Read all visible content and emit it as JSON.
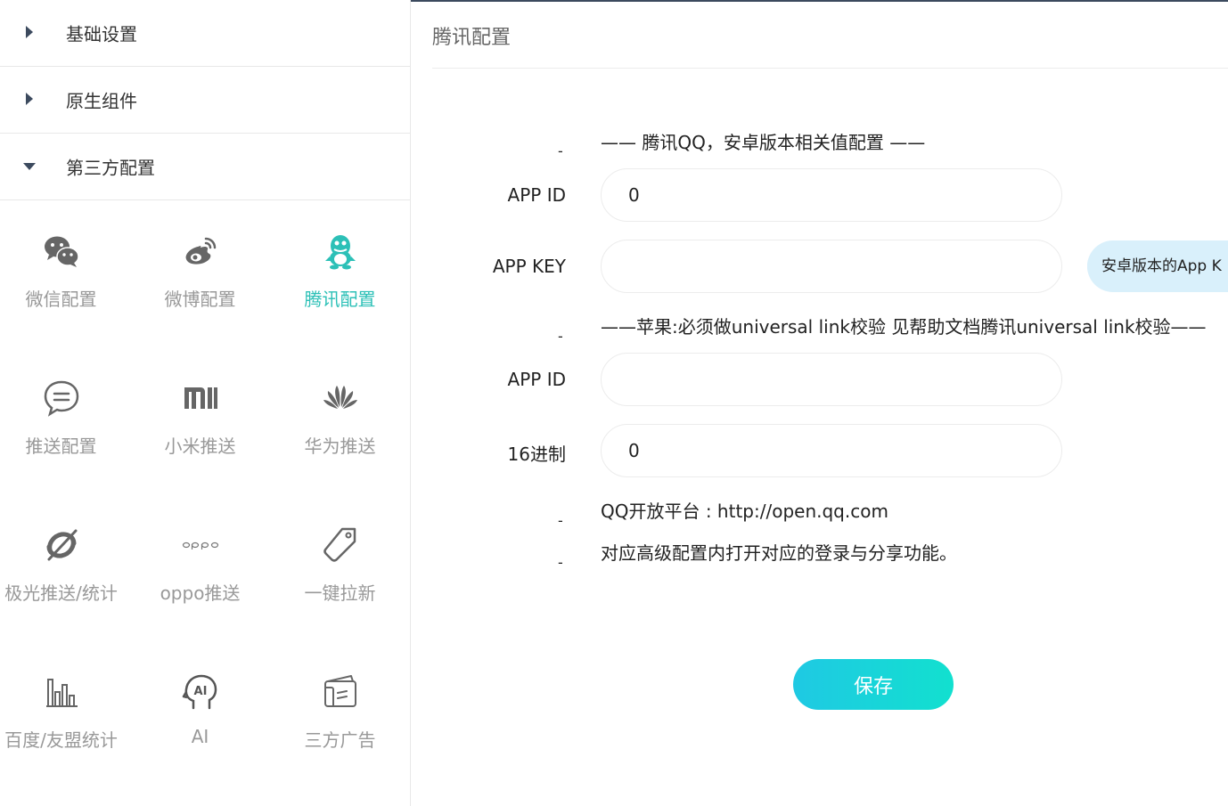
{
  "sidebar": {
    "menus": [
      {
        "label": "基础设置",
        "expanded": false
      },
      {
        "label": "原生组件",
        "expanded": false
      },
      {
        "label": "第三方配置",
        "expanded": true
      }
    ],
    "tiles": [
      {
        "label": "微信配置",
        "icon": "wechat-icon",
        "active": false
      },
      {
        "label": "微博配置",
        "icon": "weibo-icon",
        "active": false
      },
      {
        "label": "腾讯配置",
        "icon": "qq-icon",
        "active": true
      },
      {
        "label": "推送配置",
        "icon": "chat-bubble-icon",
        "active": false
      },
      {
        "label": "小米推送",
        "icon": "xiaomi-icon",
        "active": false
      },
      {
        "label": "华为推送",
        "icon": "huawei-icon",
        "active": false
      },
      {
        "label": "极光推送/统计",
        "icon": "jiguang-icon",
        "active": false
      },
      {
        "label": "oppo推送",
        "icon": "oppo-icon",
        "active": false
      },
      {
        "label": "一键拉新",
        "icon": "tag-icon",
        "active": false
      },
      {
        "label": "百度/友盟统计",
        "icon": "bar-chart-icon",
        "active": false
      },
      {
        "label": "AI",
        "icon": "ai-head-icon",
        "active": false
      },
      {
        "label": "三方广告",
        "icon": "ad-card-icon",
        "active": false
      }
    ]
  },
  "main": {
    "title": "腾讯配置",
    "android_section": "—— 腾讯QQ，安卓版本相关值配置 ——",
    "android_app_id_label": "APP ID",
    "android_app_id_value": "0",
    "android_app_key_label": "APP KEY",
    "android_app_key_value": "",
    "app_key_tooltip": "安卓版本的App K",
    "ios_section": "——苹果:必须做universal link校验 见帮助文档腾讯universal link校验——",
    "ios_app_id_label": "APP ID",
    "ios_app_id_value": "",
    "hex_label": "16进制",
    "hex_value": "0",
    "dash": "-",
    "note_platform": "QQ开放平台 : http://open.qq.com",
    "note_login": "对应高级配置内打开对应的登录与分享功能。",
    "save_label": "保存"
  },
  "colors": {
    "accent": "#2cc0b7",
    "button_start": "#1fc9e3",
    "button_end": "#12e0cf",
    "sidebar_arrow": "#3c4a5e",
    "tooltip_bg": "#d9f0fb"
  }
}
